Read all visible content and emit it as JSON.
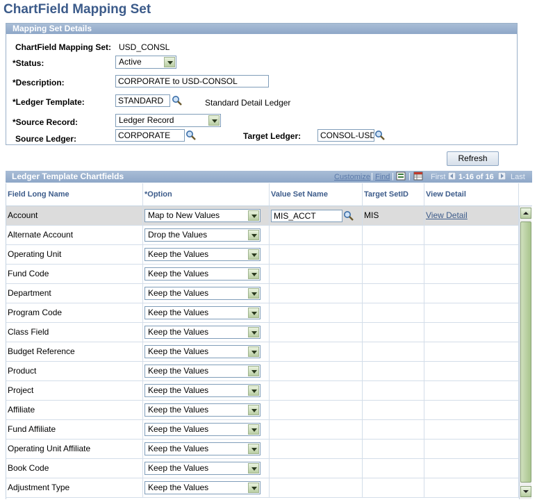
{
  "page_title": "ChartField Mapping Set",
  "details": {
    "header": "Mapping Set Details",
    "mapping_set_label": "ChartField Mapping Set:",
    "mapping_set_value": "USD_CONSL",
    "status_label": "*Status:",
    "status_value": "Active",
    "description_label": "*Description:",
    "description_value": "CORPORATE to USD-CONSOL",
    "ledger_template_label": "*Ledger Template:",
    "ledger_template_value": "STANDARD",
    "ledger_template_desc": "Standard Detail Ledger",
    "source_record_label": "*Source Record:",
    "source_record_value": "Ledger Record",
    "source_ledger_label": "Source Ledger:",
    "source_ledger_value": "CORPORATE",
    "target_ledger_label": "Target Ledger:",
    "target_ledger_value": "CONSOL-USD"
  },
  "refresh_label": "Refresh",
  "grid": {
    "title": "Ledger Template Chartfields",
    "customize": "Customize",
    "sep": "|",
    "find": "Find",
    "first": "First",
    "range": "1-16 of 16",
    "last": "Last",
    "columns": {
      "field": "Field Long Name",
      "option": "*Option",
      "value_set": "Value Set Name",
      "target": "Target SetID",
      "view": "View Detail"
    },
    "rows": [
      {
        "field": "Account",
        "option": "Map to New Values",
        "value_set": "MIS_ACCT",
        "target": "MIS",
        "view": "View Detail"
      },
      {
        "field": "Alternate Account",
        "option": "Drop the Values"
      },
      {
        "field": "Operating Unit",
        "option": "Keep the Values"
      },
      {
        "field": "Fund Code",
        "option": "Keep the Values"
      },
      {
        "field": "Department",
        "option": "Keep the Values"
      },
      {
        "field": "Program Code",
        "option": "Keep the Values"
      },
      {
        "field": "Class Field",
        "option": "Keep the Values"
      },
      {
        "field": "Budget Reference",
        "option": "Keep the Values"
      },
      {
        "field": "Product",
        "option": "Keep the Values"
      },
      {
        "field": "Project",
        "option": "Keep the Values"
      },
      {
        "field": "Affiliate",
        "option": "Keep the Values"
      },
      {
        "field": "Fund Affiliate",
        "option": "Keep the Values"
      },
      {
        "field": "Operating Unit Affiliate",
        "option": "Keep the Values"
      },
      {
        "field": "Book Code",
        "option": "Keep the Values"
      },
      {
        "field": "Adjustment Type",
        "option": "Keep the Values"
      }
    ]
  },
  "colors": {
    "header_text": "#3c5b8a",
    "panel_header": "#9ab0cf",
    "link": "#3c5b8a"
  },
  "icons": [
    "search-icon",
    "dropdown-arrow-icon",
    "download-icon",
    "view-all-icon",
    "first-arrow-icon",
    "last-arrow-icon",
    "scroll-up-icon",
    "scroll-down-icon"
  ]
}
